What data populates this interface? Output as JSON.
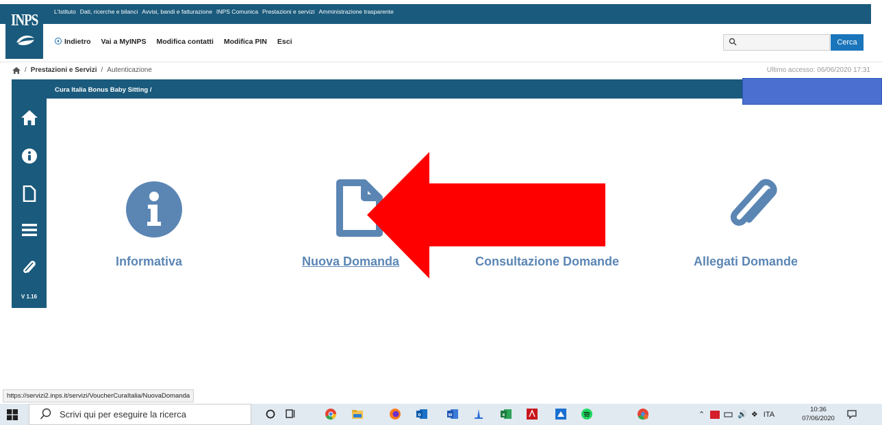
{
  "header": {
    "logo_text": "INPS",
    "top_links": [
      "L'Istituto",
      "Dati, ricerche e bilanci",
      "Avvisi, bandi e fatturazione",
      "INPS Comunica",
      "Prestazioni e servizi",
      "Amministrazione trasparente"
    ],
    "actions": {
      "back": "Indietro",
      "myinps": "Vai a MyINPS",
      "contacts": "Modifica contatti",
      "pin": "Modifica PIN",
      "exit": "Esci"
    },
    "search": {
      "placeholder": "",
      "button": "Cerca"
    }
  },
  "breadcrumb": {
    "items": [
      "Prestazioni e Servizi",
      "Autenticazione"
    ],
    "last_access": "Ultimo accesso: 06/06/2020 17:31"
  },
  "subbar": {
    "text": "Cura Italia Bonus Baby Sitting  /"
  },
  "sidebar": {
    "icons": [
      "home-icon",
      "info-icon",
      "document-icon",
      "menu-icon",
      "paperclip-icon"
    ],
    "version": "V 1.16"
  },
  "tiles": [
    {
      "label": "Informativa",
      "icon": "info-icon"
    },
    {
      "label": "Nuova Domanda",
      "icon": "document-icon"
    },
    {
      "label": "Consultazione Domande",
      "icon": ""
    },
    {
      "label": "Allegati Domande",
      "icon": "paperclip-icon"
    }
  ],
  "annotation": {
    "type": "red-arrow",
    "color": "#ff0000"
  },
  "status_url": "https://servizi2.inps.it/servizi/VoucherCuraItalia/NuovaDomanda",
  "taskbar": {
    "search_placeholder": "Scrivi qui per eseguire la ricerca",
    "language": "ITA",
    "time": "10:36",
    "date": "07/06/2020"
  },
  "colors": {
    "brand": "#1a5a7c",
    "tile_blue": "#5b86b4",
    "cerca_button": "#1a75bb"
  }
}
